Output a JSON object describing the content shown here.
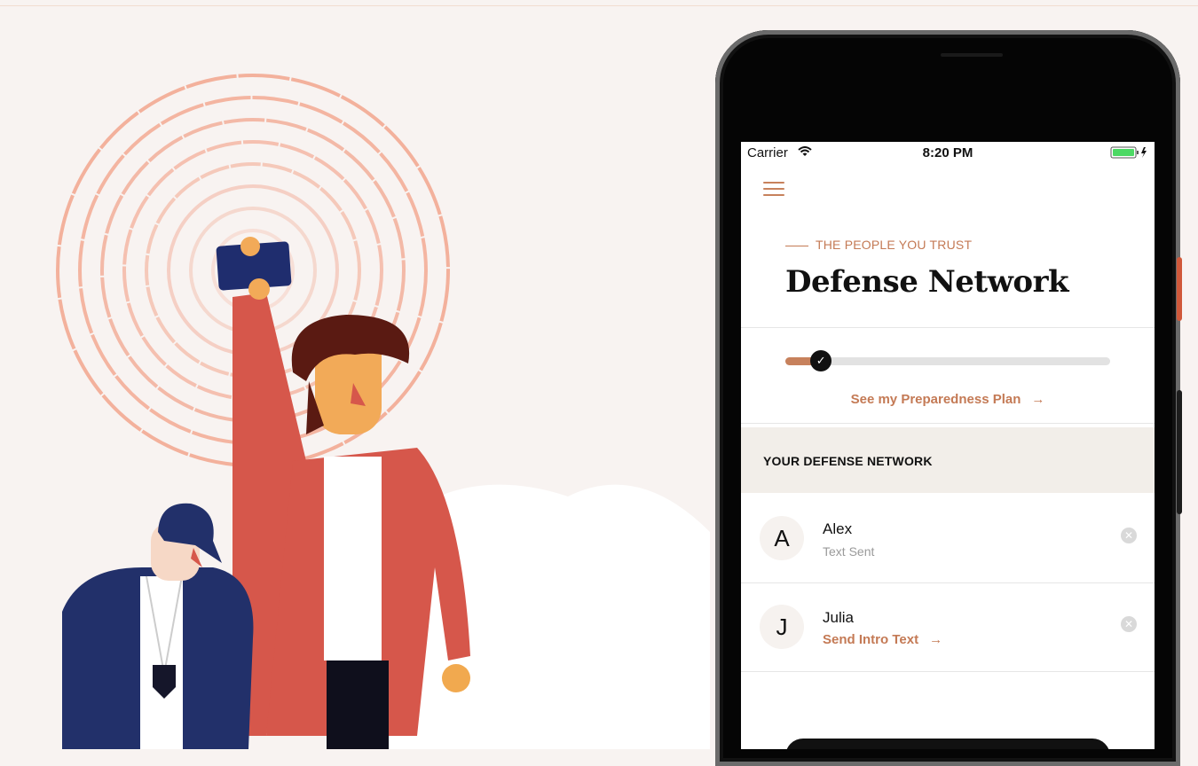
{
  "colors": {
    "accent": "#c47a55",
    "background": "#f8f3f1",
    "jacket": "#d0564a",
    "navy": "#22306a"
  },
  "illustration": {
    "icons": [
      "target-rings-icon",
      "person-raising-phone",
      "person-with-cap"
    ]
  },
  "status_bar": {
    "carrier": "Carrier",
    "time": "8:20 PM",
    "wifi_icon": "wifi-icon",
    "battery_icon": "battery-charging-icon"
  },
  "header": {
    "menu_icon": "hamburger-menu-icon",
    "eyebrow": "THE PEOPLE YOU TRUST",
    "title": "Defense Network"
  },
  "progress": {
    "fraction": 0.11,
    "check_icon": "checkmark-icon"
  },
  "plan_link": {
    "label": "See my Preparedness Plan",
    "arrow": "→"
  },
  "section": {
    "title": "YOUR DEFENSE NETWORK"
  },
  "contacts": [
    {
      "initial": "A",
      "name": "Alex",
      "status": "Text Sent",
      "remove_icon": "close-circle-icon"
    },
    {
      "initial": "J",
      "name": "Julia",
      "action": "Send Intro Text",
      "arrow": "→",
      "remove_icon": "close-circle-icon"
    }
  ]
}
